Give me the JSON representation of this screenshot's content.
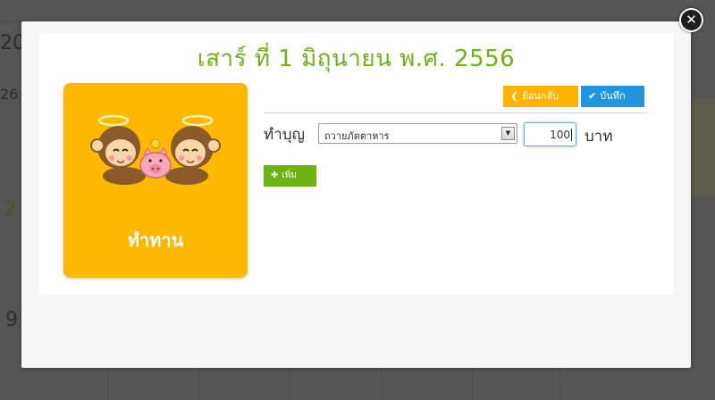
{
  "background": {
    "day_numbers": [
      "20",
      "26",
      "2",
      "9"
    ]
  },
  "dialog": {
    "title": "เสาร์ ที่ 1 มิถุนายน พ.ศ. 2556",
    "close_icon": "close-icon"
  },
  "card": {
    "label": "ทำทาน",
    "image": "monkeys-with-piggy-bank-illustration"
  },
  "toolbar": {
    "back_label": "ย้อนกลับ",
    "back_icon": "chevron-left-icon",
    "save_label": "บันทึก",
    "save_icon": "check-icon"
  },
  "form": {
    "row_label": "ทำบุญ",
    "select_value": "ถวายภัตตาหาร",
    "amount_value": "100",
    "unit_label": "บาท",
    "add_label": "เพิ่ม",
    "add_icon": "plus-icon"
  },
  "colors": {
    "title": "#6cb314",
    "card": "#ffb800",
    "back_button": "#ffb300",
    "save_button": "#2196e0",
    "add_button": "#6cb314"
  }
}
